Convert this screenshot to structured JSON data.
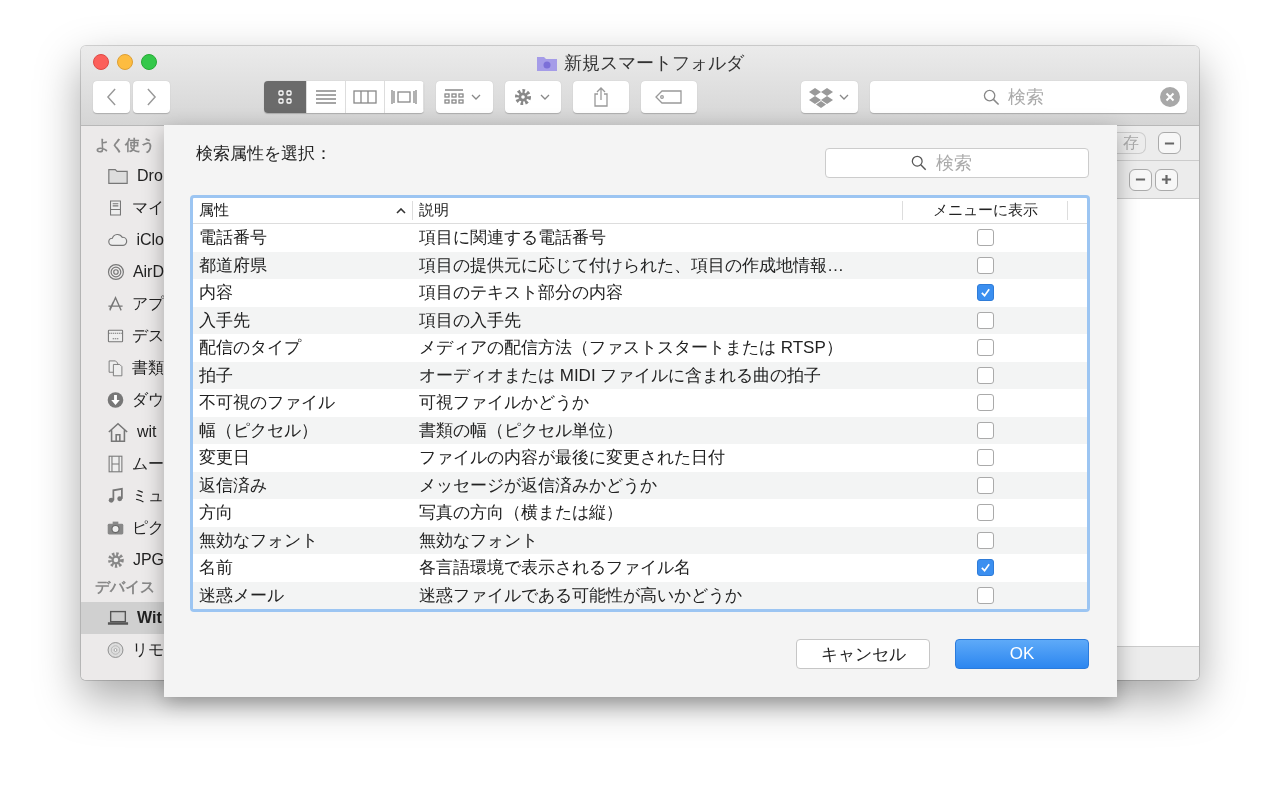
{
  "window": {
    "title": "新規スマートフォルダ"
  },
  "toolbar": {
    "view_modes": [
      {
        "kind": "icon",
        "selected": true
      },
      {
        "kind": "list",
        "selected": false
      },
      {
        "kind": "column",
        "selected": false
      },
      {
        "kind": "coverflow",
        "selected": false
      }
    ],
    "search": {
      "placeholder": "検索"
    }
  },
  "sidebar": {
    "sections": [
      {
        "title": "よく使う",
        "items": [
          {
            "label": "Dro",
            "kind": "folder",
            "selected": false
          },
          {
            "label": "マイ",
            "kind": "tray",
            "selected": false
          },
          {
            "label": "iClo",
            "kind": "cloud",
            "selected": false
          },
          {
            "label": "AirD",
            "kind": "airdrop",
            "selected": false
          },
          {
            "label": "アプ",
            "kind": "apps",
            "selected": false
          },
          {
            "label": "デス",
            "kind": "desktop",
            "selected": false
          },
          {
            "label": "書類",
            "kind": "documents",
            "selected": false
          },
          {
            "label": "ダウ",
            "kind": "download",
            "selected": false
          },
          {
            "label": "wit",
            "kind": "home",
            "selected": false
          },
          {
            "label": "ムー",
            "kind": "film",
            "selected": false
          },
          {
            "label": "ミュ",
            "kind": "music",
            "selected": false
          },
          {
            "label": "ピク",
            "kind": "camera",
            "selected": false
          },
          {
            "label": "JPG",
            "kind": "gear",
            "selected": false
          }
        ]
      },
      {
        "title": "デバイス",
        "items": [
          {
            "label": "Wit",
            "kind": "laptop",
            "selected": true
          },
          {
            "label": "リモ",
            "kind": "disc",
            "selected": false
          }
        ]
      }
    ]
  },
  "behind": {
    "save_button": "存"
  },
  "sheet": {
    "title": "検索属性を選択：",
    "search": {
      "placeholder": "検索"
    },
    "columns": [
      {
        "label": "属性",
        "sorted": true
      },
      {
        "label": "説明",
        "sorted": false
      },
      {
        "label": "メニューに表示",
        "sorted": false
      }
    ],
    "rows": [
      {
        "attribute": "電話番号",
        "description": "項目に関連する電話番号",
        "checked": false
      },
      {
        "attribute": "都道府県",
        "description": "項目の提供元に応じて付けられた、項目の作成地情報…",
        "checked": false
      },
      {
        "attribute": "内容",
        "description": "項目のテキスト部分の内容",
        "checked": true
      },
      {
        "attribute": "入手先",
        "description": "項目の入手先",
        "checked": false
      },
      {
        "attribute": "配信のタイプ",
        "description": "メディアの配信方法（ファストスタートまたは RTSP）",
        "checked": false
      },
      {
        "attribute": "拍子",
        "description": "オーディオまたは MIDI ファイルに含まれる曲の拍子",
        "checked": false
      },
      {
        "attribute": "不可視のファイル",
        "description": "可視ファイルかどうか",
        "checked": false
      },
      {
        "attribute": "幅（ピクセル）",
        "description": "書類の幅（ピクセル単位）",
        "checked": false
      },
      {
        "attribute": "変更日",
        "description": "ファイルの内容が最後に変更された日付",
        "checked": false
      },
      {
        "attribute": "返信済み",
        "description": "メッセージが返信済みかどうか",
        "checked": false
      },
      {
        "attribute": "方向",
        "description": "写真の方向（横または縦）",
        "checked": false
      },
      {
        "attribute": "無効なフォント",
        "description": "無効なフォント",
        "checked": false
      },
      {
        "attribute": "名前",
        "description": "各言語環境で表示されるファイル名",
        "checked": true
      },
      {
        "attribute": "迷惑メール",
        "description": "迷惑ファイルである可能性が高いかどうか",
        "checked": false
      }
    ],
    "buttons": [
      {
        "label": "キャンセル",
        "kind": "cancel"
      },
      {
        "label": "OK",
        "kind": "default"
      }
    ]
  }
}
